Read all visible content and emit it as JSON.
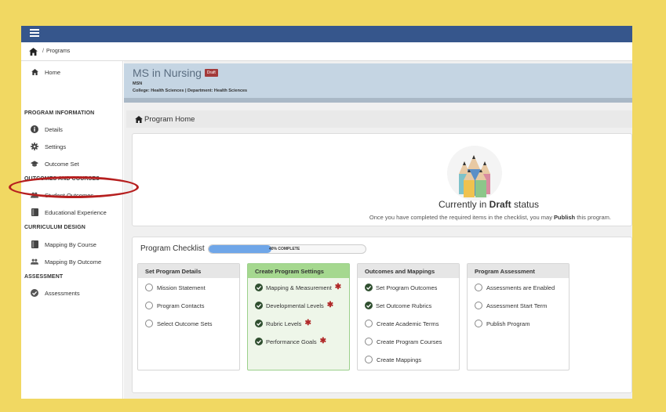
{
  "breadcrumb": {
    "separator": "/",
    "current": "Programs"
  },
  "sidebar": {
    "home": "Home",
    "sections": [
      {
        "heading": "PROGRAM INFORMATION",
        "items": [
          "Details",
          "Settings",
          "Outcome Set"
        ]
      },
      {
        "heading": "OUTCOMES AND COURSES",
        "items": [
          "Student Outcomes",
          "Educational Experience"
        ]
      },
      {
        "heading": "CURRICULUM DESIGN",
        "items": [
          "Mapping By Course",
          "Mapping By Outcome"
        ]
      },
      {
        "heading": "ASSESSMENT",
        "items": [
          "Assessments"
        ]
      }
    ]
  },
  "program": {
    "title": "MS in Nursing",
    "badge": "Draft",
    "code": "MSN",
    "college_line": "College: Health Sciences | Department: Health Sciences"
  },
  "section": {
    "title": "Program Home"
  },
  "status": {
    "prefix": "Currently in ",
    "state": "Draft",
    "suffix": " status",
    "note_before": "Once you have completed the required items in the checklist, you may ",
    "note_action": "Publish",
    "note_after": " this program."
  },
  "checklist": {
    "label": "Program Checklist",
    "progress_percent": 40,
    "progress_text": "40% COMPLETE",
    "columns": [
      {
        "title": "Set Program Details",
        "tasks": [
          {
            "label": "Mission Statement",
            "done": false
          },
          {
            "label": "Program Contacts",
            "done": false
          },
          {
            "label": "Select Outcome Sets",
            "done": false
          }
        ]
      },
      {
        "title": "Create Program Settings",
        "active": true,
        "tasks": [
          {
            "label": "Mapping & Measurement",
            "done": true,
            "required": true
          },
          {
            "label": "Developmental Levels",
            "done": true,
            "required": true
          },
          {
            "label": "Rubric Levels",
            "done": true,
            "required": true
          },
          {
            "label": "Performance Goals",
            "done": true,
            "required": true
          }
        ]
      },
      {
        "title": "Outcomes and Mappings",
        "tasks": [
          {
            "label": "Set Program Outcomes",
            "done": true
          },
          {
            "label": "Set Outcome Rubrics",
            "done": true
          },
          {
            "label": "Create Academic Terms",
            "done": false
          },
          {
            "label": "Create Program Courses",
            "done": false
          },
          {
            "label": "Create Mappings",
            "done": false
          }
        ]
      },
      {
        "title": "Program Assessment",
        "tasks": [
          {
            "label": "Assessments are Enabled",
            "done": false
          },
          {
            "label": "Assessment Start Term",
            "done": false
          },
          {
            "label": "Publish Program",
            "done": false
          }
        ]
      }
    ]
  },
  "colors": {
    "topbar": "#36568c",
    "accent_fill": "#6fa6e8",
    "done_check": "#2f4f2f",
    "required": "#b02828",
    "highlight": "#b61f1f",
    "frame": "#f1d862"
  }
}
